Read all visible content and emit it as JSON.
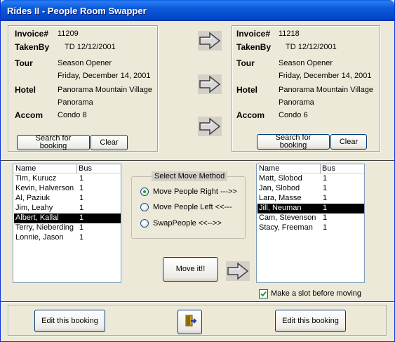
{
  "window": {
    "title": "Rides II - People Room Swapper"
  },
  "left_booking": {
    "labels": {
      "invoice": "Invoice#",
      "takenby": "TakenBy",
      "tour": "Tour",
      "hotel": "Hotel",
      "accom": "Accom"
    },
    "invoice": "11209",
    "takenby": "TD 12/12/2001",
    "tour_name": "Season Opener",
    "tour_date": "Friday, December 14, 2001",
    "hotel_name": "Panorama Mountain Village",
    "hotel_location": "Panorama",
    "accom": "Condo 8",
    "search_label": "Search for booking",
    "clear_label": "Clear"
  },
  "right_booking": {
    "labels": {
      "invoice": "Invoice#",
      "takenby": "TakenBy",
      "tour": "Tour",
      "hotel": "Hotel",
      "accom": "Accom"
    },
    "invoice": "11218",
    "takenby": "TD 12/12/2001",
    "tour_name": "Season Opener",
    "tour_date": "Friday, December 14, 2001",
    "hotel_name": "Panorama Mountain Village",
    "hotel_location": "Panorama",
    "accom": "Condo 6",
    "search_label": "Search for booking",
    "clear_label": "Clear"
  },
  "left_list": {
    "columns": [
      "Name",
      "Bus"
    ],
    "rows": [
      {
        "name": "Tim, Kurucz",
        "bus": "1"
      },
      {
        "name": "Kevin, Halverson",
        "bus": "1"
      },
      {
        "name": "Al, Paziuk",
        "bus": "1"
      },
      {
        "name": "Jim, Leahy",
        "bus": "1"
      },
      {
        "name": "Albert, Kallal",
        "bus": "1"
      },
      {
        "name": "Terry, Nieberding",
        "bus": "1"
      },
      {
        "name": "Lonnie, Jason",
        "bus": "1"
      }
    ]
  },
  "right_list": {
    "columns": [
      "Name",
      "Bus"
    ],
    "rows": [
      {
        "name": "Matt, Slobod",
        "bus": "1"
      },
      {
        "name": "Jan, Slobod",
        "bus": "1"
      },
      {
        "name": "Lara, Masse",
        "bus": "1"
      },
      {
        "name": "Jill, Neuman",
        "bus": "1"
      },
      {
        "name": "Cam, Stevenson",
        "bus": "1"
      },
      {
        "name": "Stacy, Freeman",
        "bus": "1"
      }
    ]
  },
  "move_method": {
    "title": "Select Move Method",
    "options": [
      "Move People Right --->>",
      "Move People Left <<---",
      "SwapPeople <<-->>"
    ],
    "selected": "Move People Right --->>"
  },
  "move_button": "Move it!!",
  "make_slot": {
    "label": "Make a slot before moving",
    "checked": true
  },
  "footer": {
    "edit_left": "Edit this booking",
    "edit_right": "Edit this booking"
  },
  "icons": {
    "arrows": "right-arrow-icon",
    "exit": "exit-door-icon"
  }
}
